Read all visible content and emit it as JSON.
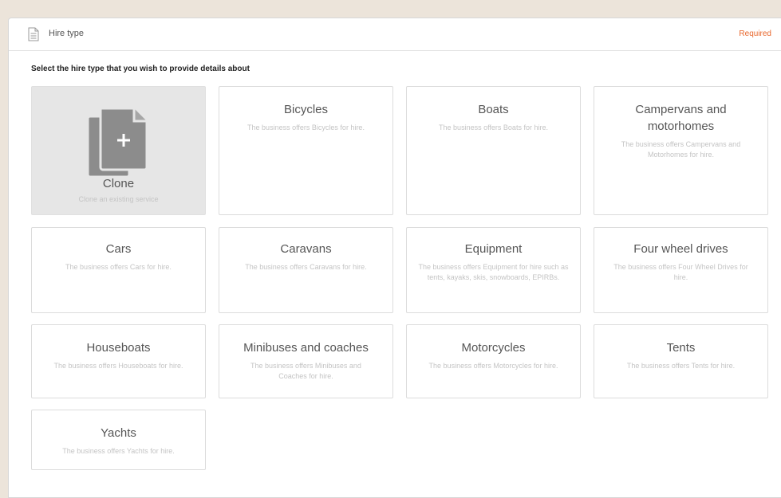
{
  "header": {
    "title": "Hire type",
    "required_label": "Required"
  },
  "instruction": "Select the hire type that you wish to provide details about",
  "clone": {
    "title": "Clone",
    "description": "Clone an existing service"
  },
  "cards": [
    {
      "title": "Bicycles",
      "description": "The business offers Bicycles for hire."
    },
    {
      "title": "Boats",
      "description": "The business offers Boats for hire."
    },
    {
      "title": "Campervans and motorhomes",
      "description": "The business offers Campervans and Motorhomes for hire."
    },
    {
      "title": "Cars",
      "description": "The business offers Cars for hire."
    },
    {
      "title": "Caravans",
      "description": "The business offers Caravans for hire."
    },
    {
      "title": "Equipment",
      "description": "The business offers Equipment for hire such as tents, kayaks, skis, snowboards, EPIRBs."
    },
    {
      "title": "Four wheel drives",
      "description": "The business offers Four Wheel Drives for hire."
    },
    {
      "title": "Houseboats",
      "description": "The business offers Houseboats for hire."
    },
    {
      "title": "Minibuses and coaches",
      "description": "The business offers Minibuses and Coaches for hire."
    },
    {
      "title": "Motorcycles",
      "description": "The business offers Motorcycles for hire."
    },
    {
      "title": "Tents",
      "description": "The business offers Tents for hire."
    },
    {
      "title": "Yachts",
      "description": "The business offers Yachts for hire."
    }
  ],
  "icons": {
    "header": "document-icon",
    "clone": "clone-documents-icon"
  },
  "colors": {
    "required": "#e8662b",
    "clone_card_bg": "#e6e6e6",
    "clone_icon": "#8c8c8c"
  }
}
